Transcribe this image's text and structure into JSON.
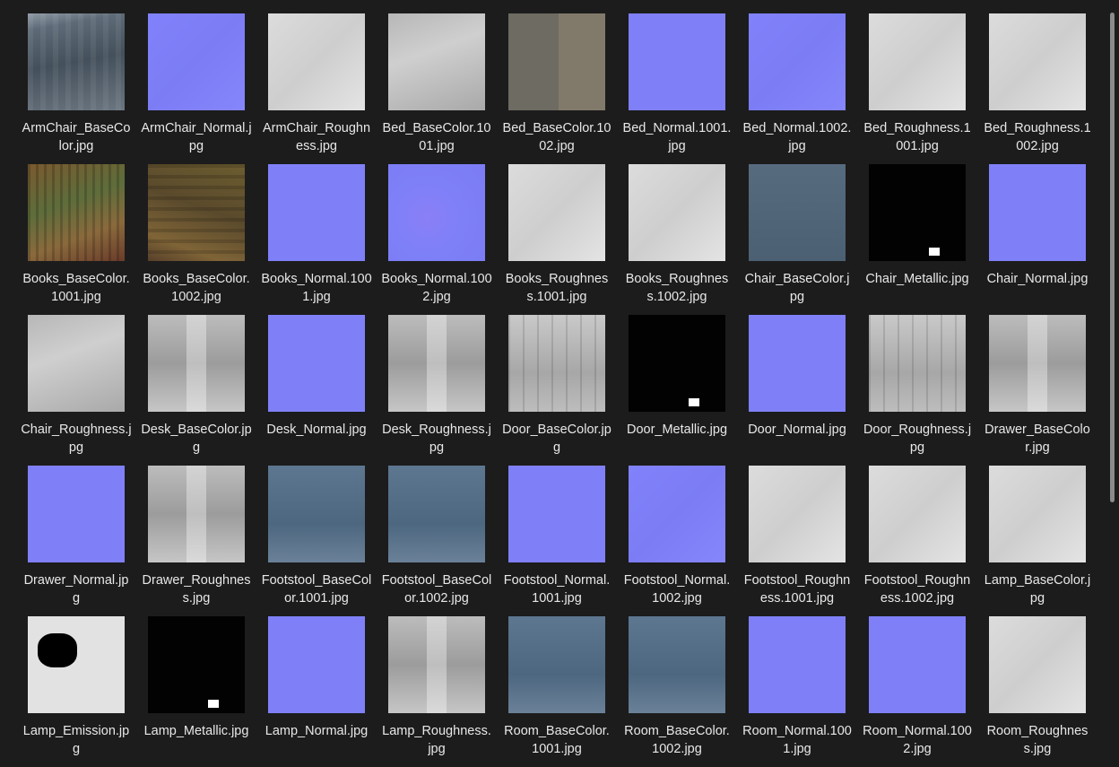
{
  "files": [
    {
      "name": "ArmChair_BaseColor.jpg",
      "style": "t-armbase"
    },
    {
      "name": "ArmChair_Normal.jpg",
      "style": "t-normal n2"
    },
    {
      "name": "ArmChair_Roughness.jpg",
      "style": "t-lightgray"
    },
    {
      "name": "Bed_BaseColor.1001.jpg",
      "style": "t-gray"
    },
    {
      "name": "Bed_BaseColor.1002.jpg",
      "style": "t-bed2"
    },
    {
      "name": "Bed_Normal.1001.jpg",
      "style": "t-normal"
    },
    {
      "name": "Bed_Normal.1002.jpg",
      "style": "t-normal n2"
    },
    {
      "name": "Bed_Roughness.1001.jpg",
      "style": "t-lightgray"
    },
    {
      "name": "Bed_Roughness.1002.jpg",
      "style": "t-lightgray"
    },
    {
      "name": "Books_BaseColor.1001.jpg",
      "style": "t-books"
    },
    {
      "name": "Books_BaseColor.1002.jpg",
      "style": "t-books2"
    },
    {
      "name": "Books_Normal.1001.jpg",
      "style": "t-normal"
    },
    {
      "name": "Books_Normal.1002.jpg",
      "style": "t-normal n3"
    },
    {
      "name": "Books_Roughness.1001.jpg",
      "style": "t-lightgray"
    },
    {
      "name": "Books_Roughness.1002.jpg",
      "style": "t-lightgray"
    },
    {
      "name": "Chair_BaseColor.jpg",
      "style": "t-navy"
    },
    {
      "name": "Chair_Metallic.jpg",
      "style": "t-black"
    },
    {
      "name": "Chair_Normal.jpg",
      "style": "t-normal"
    },
    {
      "name": "Chair_Roughness.jpg",
      "style": "t-gray"
    },
    {
      "name": "Desk_BaseColor.jpg",
      "style": "t-patch"
    },
    {
      "name": "Desk_Normal.jpg",
      "style": "t-normal"
    },
    {
      "name": "Desk_Roughness.jpg",
      "style": "t-patch"
    },
    {
      "name": "Door_BaseColor.jpg",
      "style": "t-door"
    },
    {
      "name": "Door_Metallic.jpg",
      "style": "t-black"
    },
    {
      "name": "Door_Normal.jpg",
      "style": "t-normal"
    },
    {
      "name": "Door_Roughness.jpg",
      "style": "t-door"
    },
    {
      "name": "Drawer_BaseColor.jpg",
      "style": "t-patch"
    },
    {
      "name": "Drawer_Normal.jpg",
      "style": "t-normal"
    },
    {
      "name": "Drawer_Roughness.jpg",
      "style": "t-patch"
    },
    {
      "name": "Footstool_BaseColor.1001.jpg",
      "style": "t-blue"
    },
    {
      "name": "Footstool_BaseColor.1002.jpg",
      "style": "t-blue"
    },
    {
      "name": "Footstool_Normal.1001.jpg",
      "style": "t-normal"
    },
    {
      "name": "Footstool_Normal.1002.jpg",
      "style": "t-normal n2"
    },
    {
      "name": "Footstool_Roughness.1001.jpg",
      "style": "t-lightgray"
    },
    {
      "name": "Footstool_Roughness.1002.jpg",
      "style": "t-lightgray"
    },
    {
      "name": "Lamp_BaseColor.jpg",
      "style": "t-lightgray"
    },
    {
      "name": "Lamp_Emission.jpg",
      "style": "t-white"
    },
    {
      "name": "Lamp_Metallic.jpg",
      "style": "t-black"
    },
    {
      "name": "Lamp_Normal.jpg",
      "style": "t-normal"
    },
    {
      "name": "Lamp_Roughness.jpg",
      "style": "t-patch"
    },
    {
      "name": "Room_BaseColor.1001.jpg",
      "style": "t-blue"
    },
    {
      "name": "Room_BaseColor.1002.jpg",
      "style": "t-blue"
    },
    {
      "name": "Room_Normal.1001.jpg",
      "style": "t-normal"
    },
    {
      "name": "Room_Normal.1002.jpg",
      "style": "t-normal"
    },
    {
      "name": "Room_Roughness.jpg",
      "style": "t-lightgray"
    }
  ]
}
